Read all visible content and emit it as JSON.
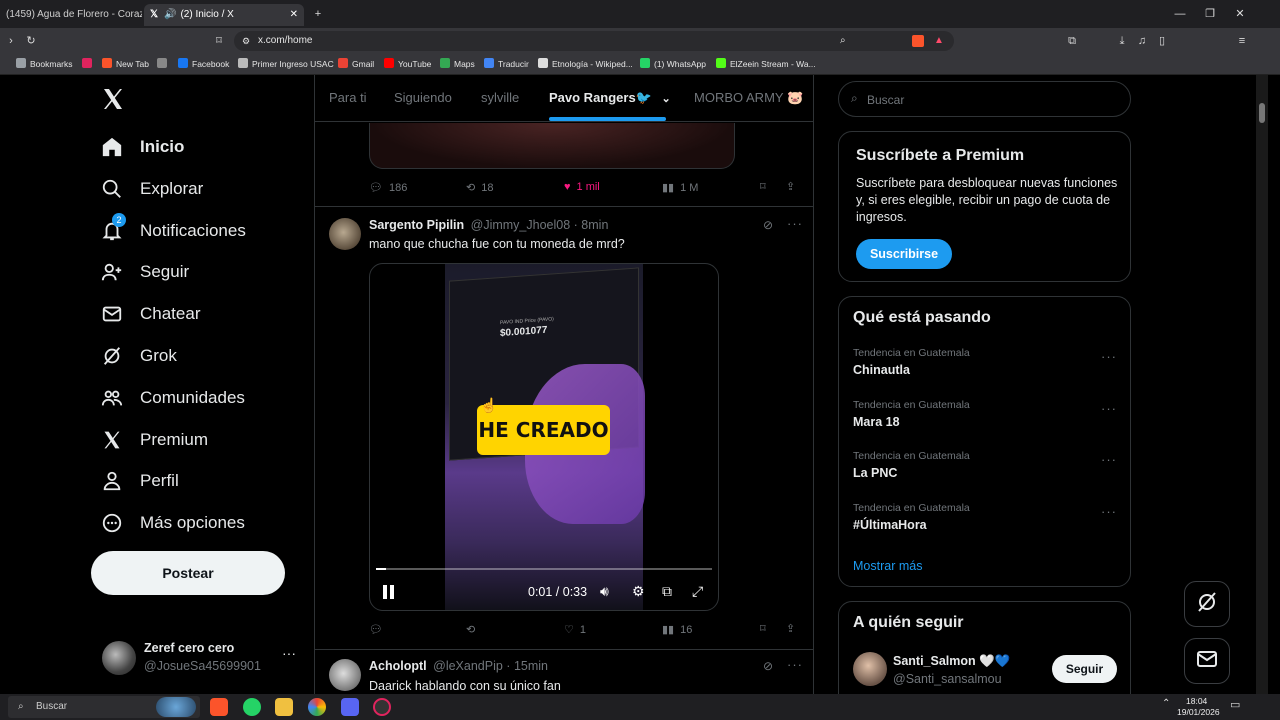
{
  "browser": {
    "tabs": [
      {
        "title": "(1459) Agua de Florero - Corazón Pa"
      },
      {
        "title": "(2) Inicio / X"
      }
    ],
    "url": "x.com/home",
    "bookmarks": [
      {
        "label": "Bookmarks",
        "color": "#9aa0a6"
      },
      {
        "label": "",
        "color": "#e0245e"
      },
      {
        "label": "New Tab",
        "color": "#fb542b"
      },
      {
        "label": "",
        "color": "#888888"
      },
      {
        "label": "Facebook",
        "color": "#1877f2"
      },
      {
        "label": "Primer Ingreso USAC",
        "color": "#bbbbbb"
      },
      {
        "label": "Gmail",
        "color": "#ea4335"
      },
      {
        "label": "YouTube",
        "color": "#ff0000"
      },
      {
        "label": "Maps",
        "color": "#34a853"
      },
      {
        "label": "Traducir",
        "color": "#4285f4"
      },
      {
        "label": "Etnología - Wikiped...",
        "color": "#dddddd"
      },
      {
        "label": "(1) WhatsApp",
        "color": "#25d366"
      },
      {
        "label": "ElZeein Stream - Wa...",
        "color": "#53fc18"
      }
    ]
  },
  "sidebar": {
    "items": [
      {
        "label": "Inicio",
        "icon": "home-icon"
      },
      {
        "label": "Explorar",
        "icon": "search-icon"
      },
      {
        "label": "Notificaciones",
        "icon": "bell-icon",
        "badge": "2"
      },
      {
        "label": "Seguir",
        "icon": "follow-icon"
      },
      {
        "label": "Chatear",
        "icon": "mail-icon"
      },
      {
        "label": "Grok",
        "icon": "grok-icon"
      },
      {
        "label": "Comunidades",
        "icon": "communities-icon"
      },
      {
        "label": "Premium",
        "icon": "x-logo-icon"
      },
      {
        "label": "Perfil",
        "icon": "person-icon"
      },
      {
        "label": "Más opciones",
        "icon": "more-circle-icon"
      }
    ],
    "post_button": "Postear",
    "account": {
      "name": "Zeref cero cero",
      "handle": "@JosueSa45699901"
    }
  },
  "feed": {
    "tabs": [
      "Para ti",
      "Siguiendo",
      "sylville",
      "Pavo Rangers🐦",
      "MORBO ARMY 🐷"
    ],
    "active_tab": 3,
    "prev_actions": {
      "replies": "186",
      "reposts": "18",
      "likes": "1 mil",
      "views": "1 M"
    },
    "tweet": {
      "name": "Sargento Pipilin",
      "handle": "@Jimmy_Jhoel08",
      "time": "8min",
      "text": "mano que chucha fue con tu moneda de mrd?",
      "video_caption": "HE CREADO",
      "video_screen": {
        "price_label": "PAVO IND Price (PAVO)",
        "price": "$0.001077"
      },
      "video_time": "0:01 / 0:33",
      "progress_fraction": 0.03,
      "actions": {
        "replies": "",
        "reposts": "",
        "likes": "1",
        "views": "16"
      }
    },
    "next_tweet": {
      "name": "Acholoptl",
      "handle": "@leXandPip",
      "time": "15min",
      "text": "Daarick hablando con su único fan"
    }
  },
  "right": {
    "search_placeholder": "Buscar",
    "premium": {
      "title": "Suscríbete a Premium",
      "body": "Suscríbete para desbloquear nuevas funciones y, si eres elegible, recibir un pago de cuota de ingresos.",
      "button": "Suscribirse"
    },
    "trends": {
      "title": "Qué está pasando",
      "items": [
        {
          "context": "Tendencia en Guatemala",
          "topic": "Chinautla"
        },
        {
          "context": "Tendencia en Guatemala",
          "topic": "Mara 18"
        },
        {
          "context": "Tendencia en Guatemala",
          "topic": "La PNC"
        },
        {
          "context": "Tendencia en Guatemala",
          "topic": "#ÚltimaHora"
        }
      ],
      "show_more": "Mostrar más"
    },
    "who_to_follow": {
      "title": "A quién seguir",
      "name": "Santi_Salmon 🤍💙",
      "handle": "@Santi_sansalmou",
      "button": "Seguir"
    }
  },
  "taskbar": {
    "search": "Buscar",
    "time": "18:04",
    "date": "19/01/2026"
  },
  "colors": {
    "accent": "#1d9bf0",
    "like": "#f91880",
    "caption_bg": "#ffd400"
  }
}
